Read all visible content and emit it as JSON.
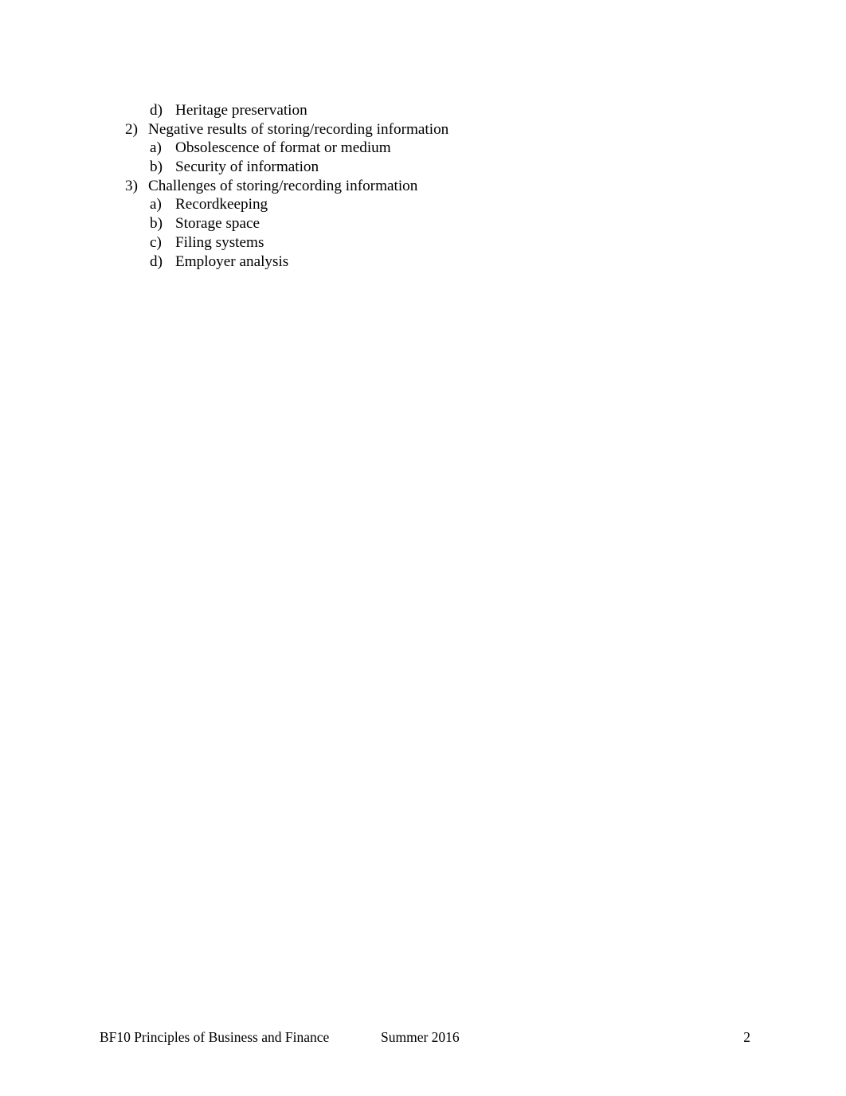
{
  "document": {
    "page_background": "#ffffff",
    "text_color": "#000000",
    "outline": [
      {
        "level": 2,
        "marker": "d)",
        "text": "Heritage preservation"
      },
      {
        "level": 1,
        "marker": "2)",
        "text": "Negative results of storing/recording information"
      },
      {
        "level": 2,
        "marker": "a)",
        "text": "Obsolescence of format or medium"
      },
      {
        "level": 2,
        "marker": "b)",
        "text": "Security of information"
      },
      {
        "level": 1,
        "marker": "3)",
        "text": "Challenges of storing/recording information"
      },
      {
        "level": 2,
        "marker": "a)",
        "text": "Recordkeeping"
      },
      {
        "level": 2,
        "marker": "b)",
        "text": "Storage space"
      },
      {
        "level": 2,
        "marker": "c)",
        "text": "Filing systems"
      },
      {
        "level": 2,
        "marker": "d)",
        "text": "Employer analysis"
      }
    ]
  },
  "footer": {
    "course": "BF10 Principles of Business and Finance",
    "term": "Summer 2016",
    "page_number": "2"
  }
}
